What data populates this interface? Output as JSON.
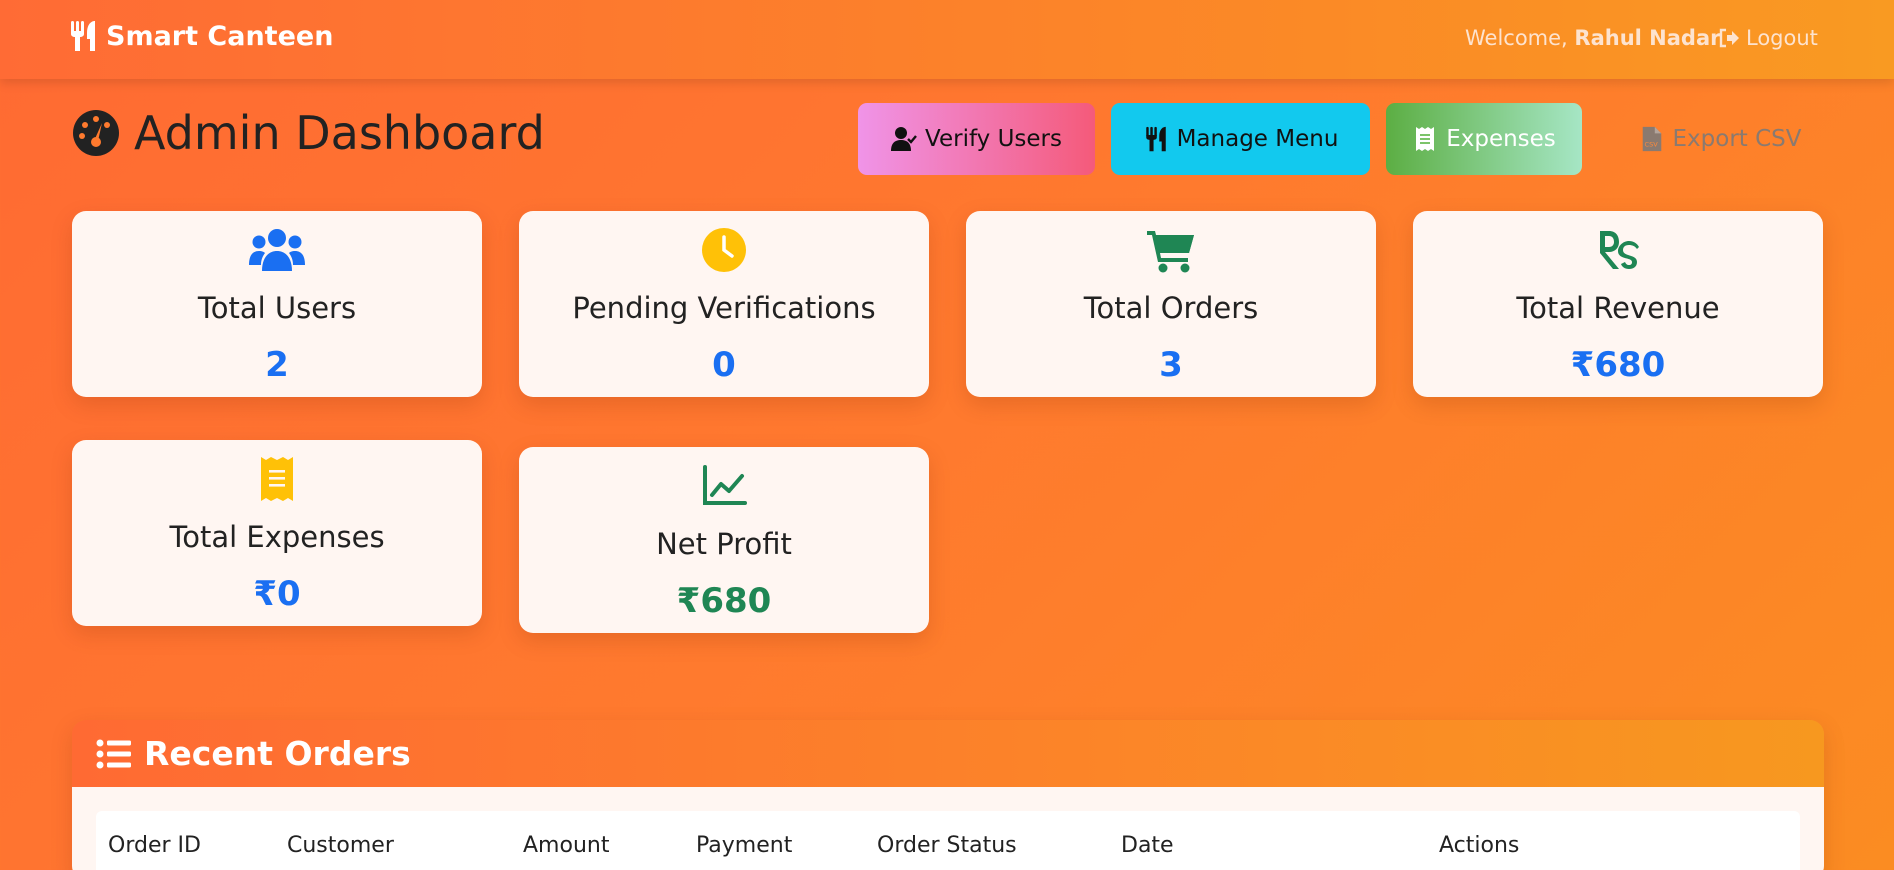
{
  "navbar": {
    "brand": "Smart Canteen",
    "welcome_prefix": "Welcome,",
    "user_name": "Rahul Nadar",
    "logout_label": "Logout"
  },
  "page": {
    "title": "Admin Dashboard"
  },
  "actions": {
    "verify_users": "Verify Users",
    "manage_menu": "Manage Menu",
    "expenses": "Expenses",
    "export_csv": "Export CSV"
  },
  "stats": [
    {
      "label": "Total Users",
      "value": "2",
      "icon": "users-icon",
      "icon_color": "#1a6ff2"
    },
    {
      "label": "Pending Verifications",
      "value": "0",
      "icon": "clock-icon",
      "icon_color": "#ffc107"
    },
    {
      "label": "Total Orders",
      "value": "3",
      "icon": "cart-icon",
      "icon_color": "#1f8654"
    },
    {
      "label": "Total Revenue",
      "value": "₹680",
      "icon": "rupee-icon",
      "icon_color": "#1f8654"
    },
    {
      "label": "Total Expenses",
      "value": "₹0",
      "icon": "receipt-icon",
      "icon_color": "#ffc107"
    },
    {
      "label": "Net Profit",
      "value": "₹680",
      "icon": "chart-line-icon",
      "icon_color": "#1f8654"
    }
  ],
  "orders": {
    "title": "Recent Orders",
    "columns": [
      "Order ID",
      "Customer",
      "Amount",
      "Payment",
      "Order Status",
      "Date",
      "Actions"
    ]
  },
  "colors": {
    "accent_orange": "#ff6b35",
    "value_blue": "#1a6ff2",
    "value_green": "#1f8654",
    "card_bg": "#fff6f2"
  }
}
